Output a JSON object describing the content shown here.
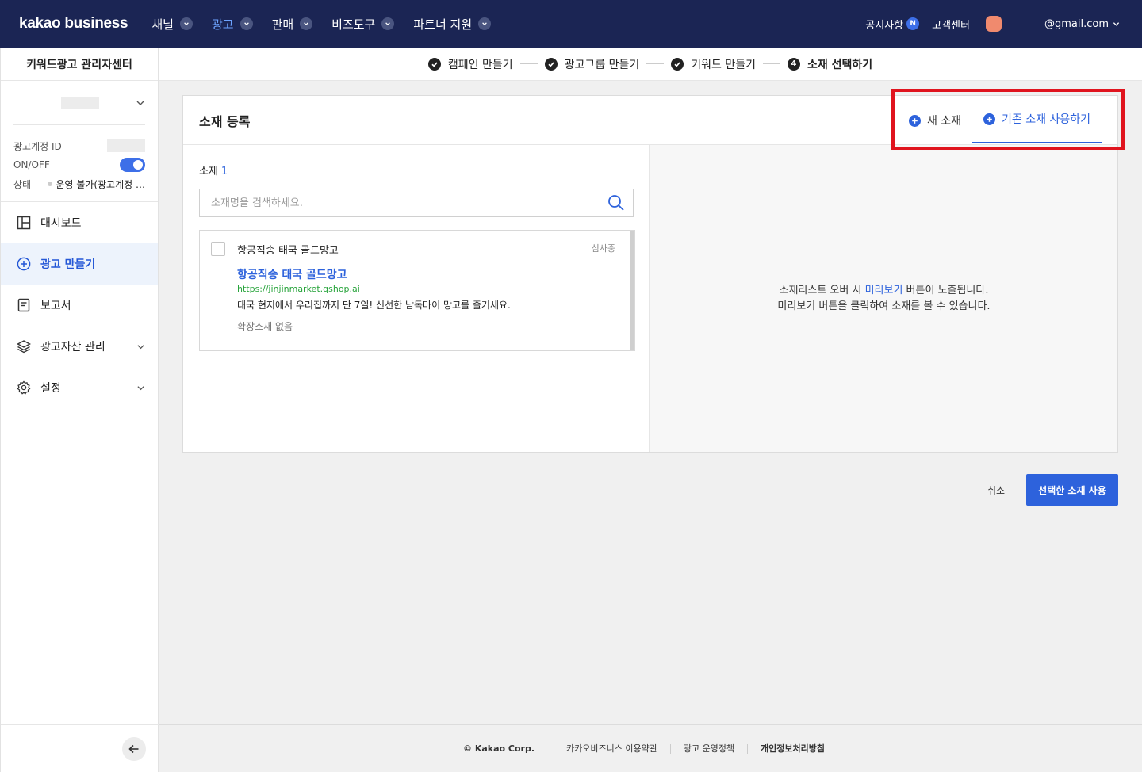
{
  "app": {
    "logo": "kakao business",
    "nav": [
      {
        "label": "채널"
      },
      {
        "label": "광고"
      },
      {
        "label": "판매"
      },
      {
        "label": "비즈도구"
      },
      {
        "label": "파트너 지원"
      }
    ],
    "notice_label": "공지사항",
    "notice_badge": "N",
    "support_label": "고객센터",
    "account_email": "@gmail.com"
  },
  "sidebar": {
    "title": "키워드광고 관리자센터",
    "info": {
      "account_id_label": "광고계정 ID",
      "onoff_label": "ON/OFF",
      "onoff_state": "on",
      "status_label": "상태",
      "status_value": "운영 불가(광고계정 …"
    },
    "menu": [
      {
        "label": "대시보드",
        "icon": "dashboard-icon"
      },
      {
        "label": "광고 만들기",
        "icon": "plus-circle-icon"
      },
      {
        "label": "보고서",
        "icon": "report-icon"
      },
      {
        "label": "광고자산 관리",
        "icon": "layers-icon"
      },
      {
        "label": "설정",
        "icon": "gear-icon"
      }
    ]
  },
  "stepper": {
    "steps": [
      {
        "label": "캠페인 만들기",
        "state": "done"
      },
      {
        "label": "광고그룹 만들기",
        "state": "done"
      },
      {
        "label": "키워드 만들기",
        "state": "done"
      },
      {
        "label": "소재 선택하기",
        "state": "current",
        "number": "4"
      }
    ]
  },
  "card": {
    "title": "소재 등록",
    "tabs": [
      {
        "label": "새 소재"
      },
      {
        "label": "기존 소재 사용하기"
      }
    ],
    "count_label": "소재",
    "count": "1",
    "search_placeholder": "소재명을 검색하세요.",
    "result": {
      "name": "항공직송 태국 골드망고",
      "status": "심사중",
      "ad_title": "항공직송 태국 골드망고",
      "ad_url": "https://jinjinmarket.qshop.ai",
      "ad_desc": "태국 현지에서 우리집까지 단 7일! 신선한 남독마이 망고를 즐기세요.",
      "ad_ext": "확장소재 없음"
    },
    "preview_line1_pre": "소재리스트 오버 시 ",
    "preview_line1_link": "미리보기",
    "preview_line1_post": " 버튼이 노출됩니다.",
    "preview_line2": "미리보기 버튼을 클릭하여 소재를 볼 수 있습니다."
  },
  "actions": {
    "cancel": "취소",
    "use_selected": "선택한 소재 사용"
  },
  "footer": {
    "copyright": "© Kakao Corp.",
    "links": [
      "카카오비즈니스 이용약관",
      "광고 운영정책",
      "개인정보처리방침"
    ]
  },
  "colors": {
    "nav_bg": "#1b2554",
    "accent": "#2d62dc",
    "highlight": "#e0141e"
  }
}
